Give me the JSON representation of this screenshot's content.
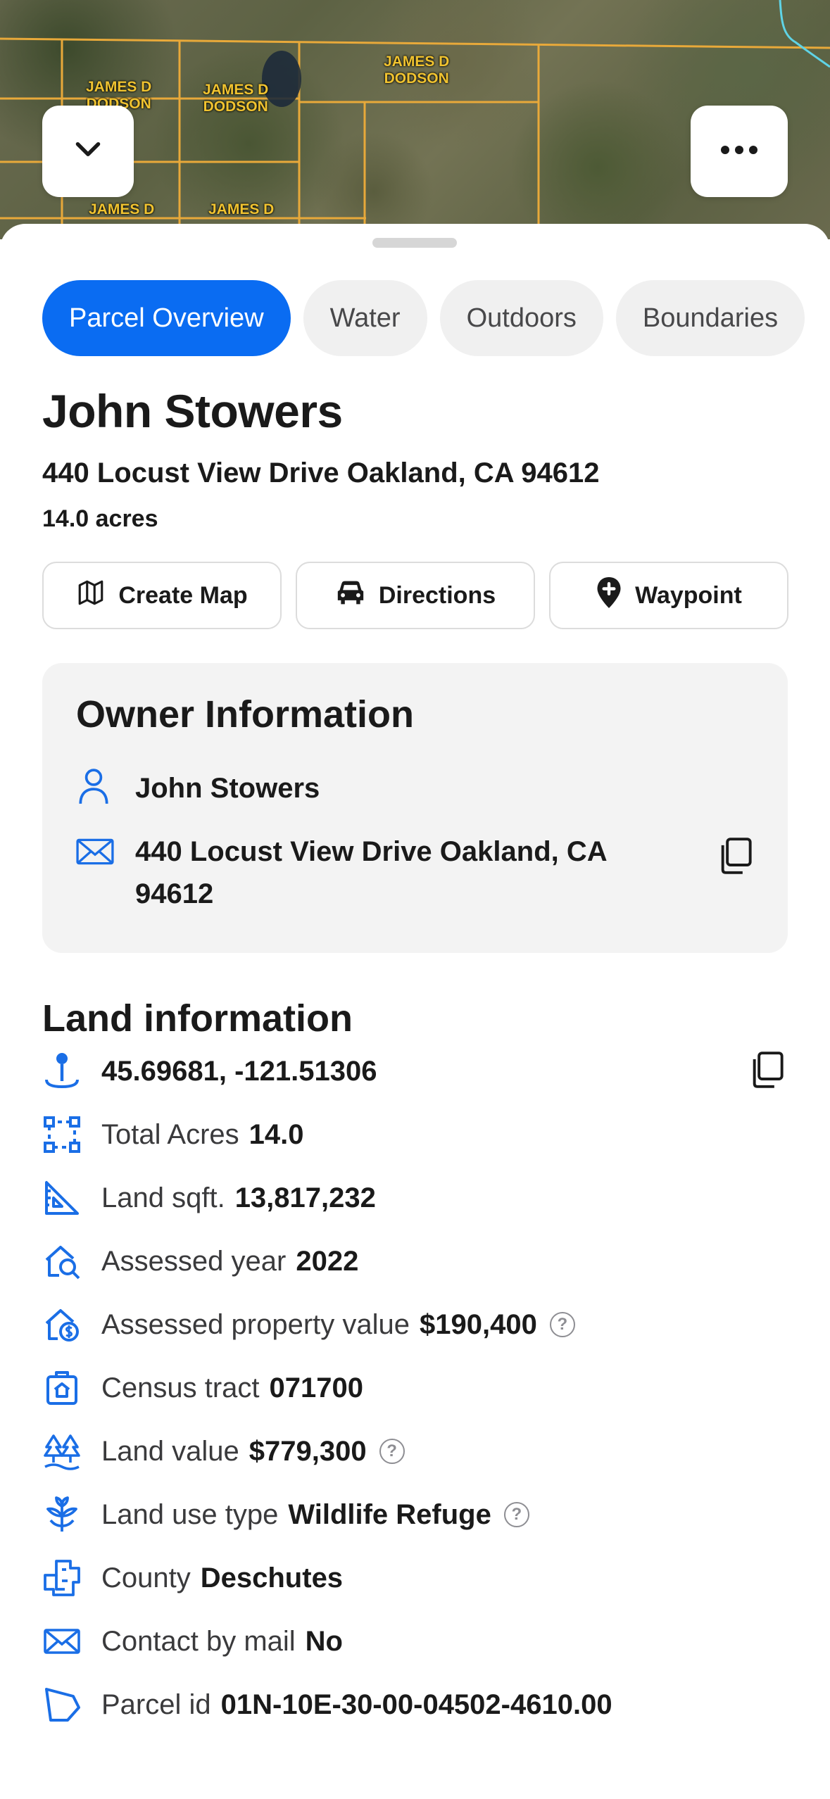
{
  "map": {
    "parcel_labels": [
      "JAMES D\nDODSON",
      "JAMES D\nDODSON",
      "JAMES D\nDODSON",
      "JAMES D",
      "JAMES D"
    ],
    "collapse_icon": "chevron-down-icon",
    "more_icon": "more-horizontal-icon"
  },
  "tabs": [
    {
      "label": "Parcel Overview",
      "active": true
    },
    {
      "label": "Water",
      "active": false
    },
    {
      "label": "Outdoors",
      "active": false
    },
    {
      "label": "Boundaries",
      "active": false
    }
  ],
  "parcel": {
    "owner_name": "John Stowers",
    "address": "440 Locust View Drive Oakland, CA 94612",
    "acres": "14.0 acres"
  },
  "actions": [
    {
      "label": "Create Map",
      "icon": "map-icon"
    },
    {
      "label": "Directions",
      "icon": "car-icon"
    },
    {
      "label": "Waypoint",
      "icon": "waypoint-pin-icon"
    }
  ],
  "owner_info": {
    "title": "Owner Information",
    "name": "John Stowers",
    "mailing_address": "440 Locust View Drive Oakland, CA 94612"
  },
  "land_info": {
    "title": "Land information",
    "coordinates": "45.69681, -121.51306",
    "rows": [
      {
        "label": "Total Acres",
        "value": "14.0",
        "icon": "area-select-icon",
        "help": false
      },
      {
        "label": "Land sqft.",
        "value": "13,817,232",
        "icon": "ruler-triangle-icon",
        "help": false
      },
      {
        "label": "Assessed year",
        "value": "2022",
        "icon": "house-search-icon",
        "help": false
      },
      {
        "label": "Assessed property value",
        "value": "$190,400",
        "icon": "house-dollar-icon",
        "help": true
      },
      {
        "label": "Census tract",
        "value": "071700",
        "icon": "census-building-icon",
        "help": false
      },
      {
        "label": "Land value",
        "value": "$779,300",
        "icon": "trees-icon",
        "help": true
      },
      {
        "label": "Land use type",
        "value": "Wildlife Refuge",
        "icon": "plant-icon",
        "help": true
      },
      {
        "label": "County",
        "value": "Deschutes",
        "icon": "county-map-icon",
        "help": false
      },
      {
        "label": "Contact by mail",
        "value": "No",
        "icon": "mail-icon",
        "help": false
      },
      {
        "label": "Parcel id",
        "value": "01N-10E-30-00-04502-4610.00",
        "icon": "parcel-shape-icon",
        "help": false
      }
    ],
    "help_glyph": "?"
  },
  "colors": {
    "accent": "#0a6cf2",
    "parcel_line": "#e8a93a",
    "parcel_label": "#f0c330",
    "icon_blue": "#1a6ee6"
  }
}
